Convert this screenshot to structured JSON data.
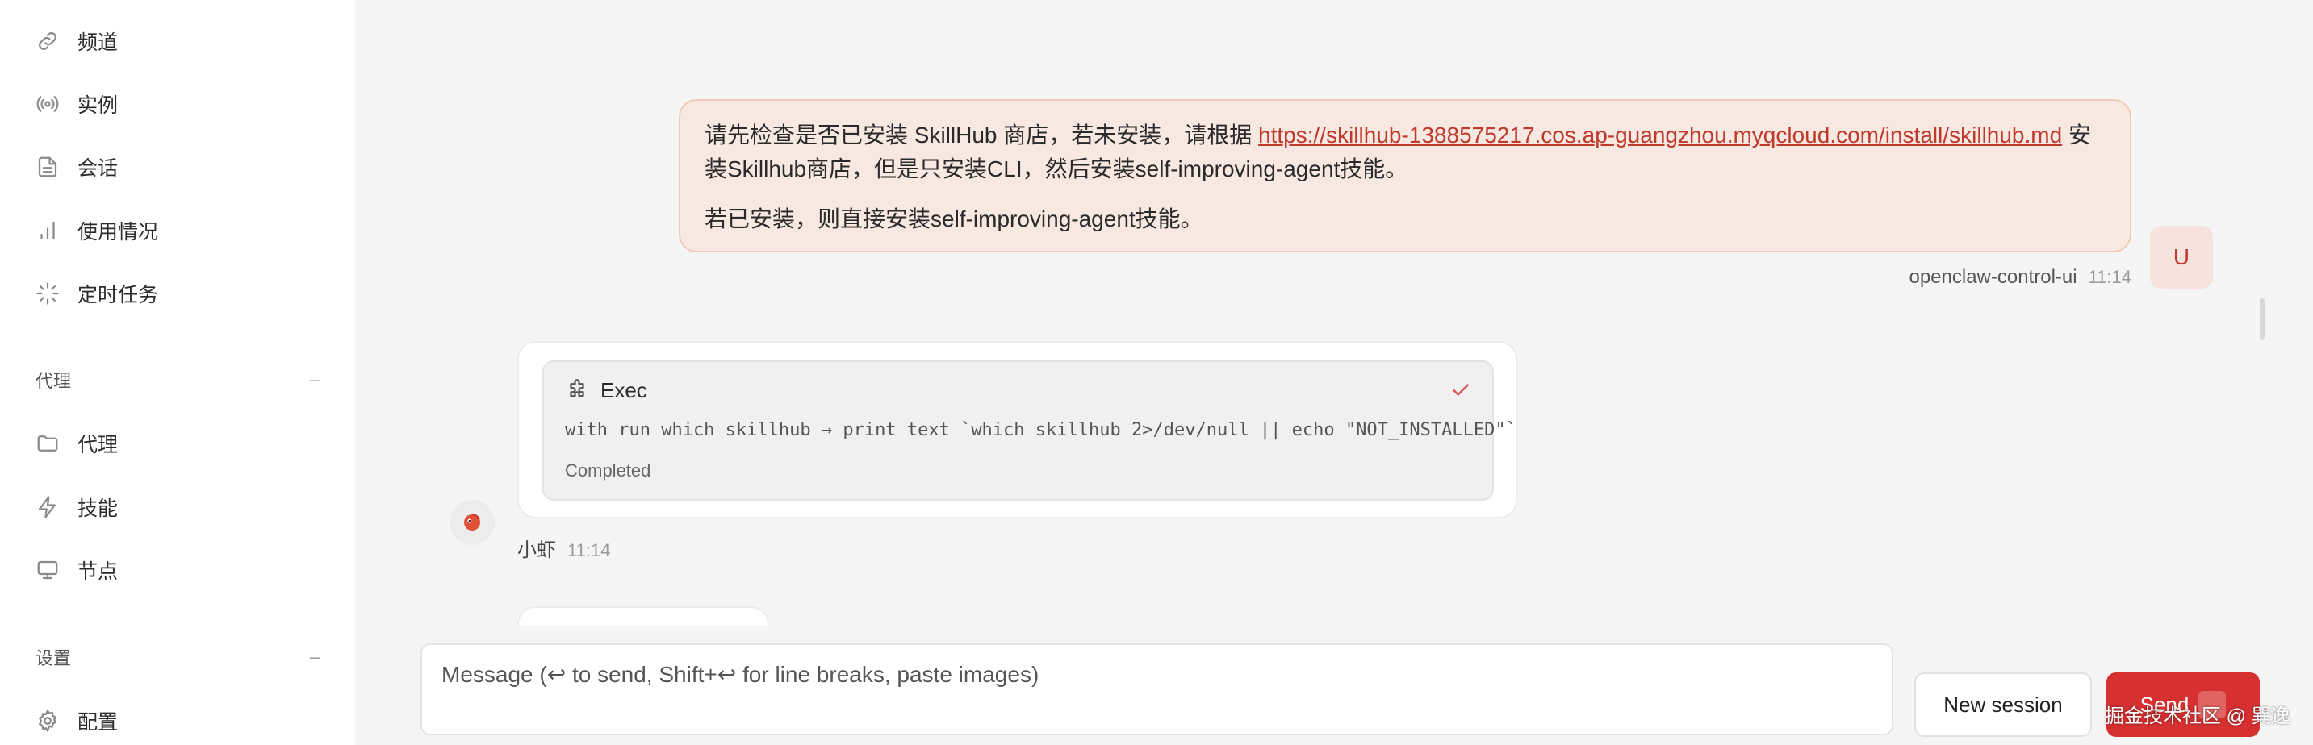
{
  "sidebar": {
    "top_items": [
      {
        "label": "频道",
        "icon": "link-icon"
      },
      {
        "label": "实例",
        "icon": "broadcast-icon"
      },
      {
        "label": "会话",
        "icon": "document-icon"
      },
      {
        "label": "使用情况",
        "icon": "bar-chart-icon"
      },
      {
        "label": "定时任务",
        "icon": "loader-icon"
      }
    ],
    "section_agent": {
      "title": "代理",
      "toggle": "–"
    },
    "agent_items": [
      {
        "label": "代理",
        "icon": "folder-icon"
      },
      {
        "label": "技能",
        "icon": "bolt-icon"
      },
      {
        "label": "节点",
        "icon": "monitor-icon"
      }
    ],
    "section_settings": {
      "title": "设置",
      "toggle": "–"
    },
    "settings_items": [
      {
        "label": "配置",
        "icon": "gear-icon"
      }
    ]
  },
  "chat": {
    "user_message": {
      "text_before": "请先检查是否已安装 SkillHub 商店，若未安装，请根据 ",
      "link": "https://skillhub-1388575217.cos.ap-guangzhou.myqcloud.com/install/skillhub.md",
      "text_after": " 安装Skillhub商店，但是只安装CLI，然后安装self-improving-agent技能。",
      "second_paragraph": "若已安装，则直接安装self-improving-agent技能。",
      "sender": "openclaw-control-ui",
      "time": "11:14",
      "avatar_letter": "U"
    },
    "tool_call": {
      "title": "Exec",
      "command": "with run which skillhub → print text `which skillhub 2>/dev/null || echo \"NOT_INSTALLED\"`",
      "status": "Completed",
      "status_color": "#d9534f"
    },
    "assistant": {
      "name": "小虾",
      "time": "11:14"
    }
  },
  "composer": {
    "placeholder": "Message (↩ to send, Shift+↩ for line breaks, paste images)",
    "new_session_label": "New session",
    "send_label": "Send"
  },
  "watermark": "掘金技术社区 @ 巽逸",
  "colors": {
    "accent": "#d63031",
    "user_bubble_bg": "#f7e8e1",
    "link": "#c0392b"
  }
}
